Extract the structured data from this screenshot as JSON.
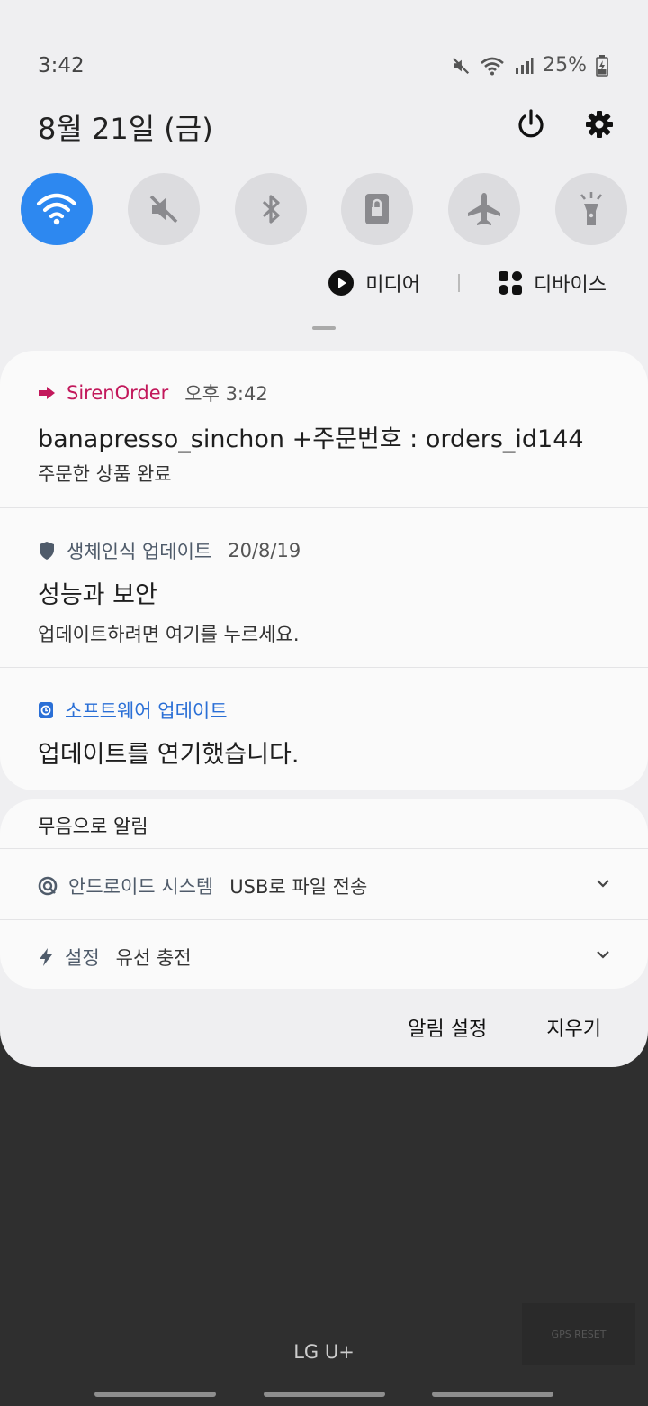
{
  "status_bar": {
    "time": "3:42",
    "battery": "25%"
  },
  "header": {
    "date": "8월 21일 (금)"
  },
  "quick_toggles": [
    {
      "name": "wifi",
      "state": "on"
    },
    {
      "name": "sound-off",
      "state": "off"
    },
    {
      "name": "bluetooth",
      "state": "off"
    },
    {
      "name": "screen-lock",
      "state": "off"
    },
    {
      "name": "airplane",
      "state": "off"
    },
    {
      "name": "flashlight",
      "state": "off"
    }
  ],
  "media_row": {
    "media_label": "미디어",
    "devices_label": "디바이스"
  },
  "notifications": [
    {
      "app": "SirenOrder",
      "time": "오후 3:42",
      "title": "banapresso_sinchon +주문번호 : orders_id144",
      "body": "주문한 상품 완료",
      "app_color": "#c2185b"
    },
    {
      "app": "생체인식 업데이트",
      "time": "20/8/19",
      "title": "성능과 보안",
      "body": "업데이트하려면 여기를 누르세요.",
      "app_color": "#4f5b6a"
    },
    {
      "app": "소프트웨어 업데이트",
      "title": "업데이트를 연기했습니다.",
      "app_color": "#2a6fd6"
    }
  ],
  "silent": {
    "header": "무음으로 알림",
    "items": [
      {
        "app": "안드로이드 시스템",
        "text": "USB로 파일 전송",
        "app_color": "#4f5b6a"
      },
      {
        "app": "설정",
        "text": "유선 충전",
        "app_color": "#4f5b6a"
      }
    ]
  },
  "actions": {
    "settings": "알림 설정",
    "clear": "지우기"
  },
  "carrier": "LG U+",
  "overlay": {
    "gps_label": "GPS RESET"
  }
}
